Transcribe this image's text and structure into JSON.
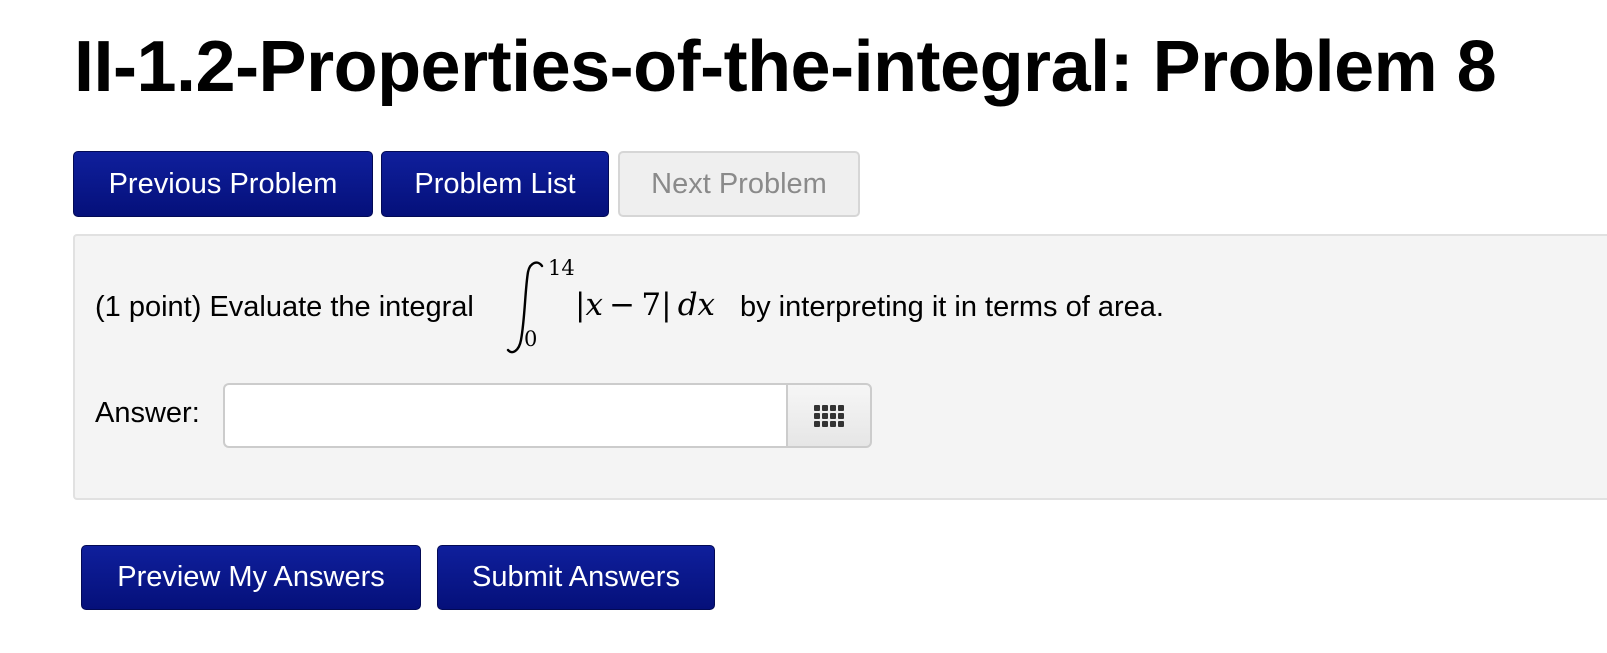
{
  "page": {
    "title": "II-1.2-Properties-of-the-integral: Problem 8"
  },
  "nav": {
    "previous_label": "Previous Problem",
    "list_label": "Problem List",
    "next_label": "Next Problem",
    "next_disabled": true
  },
  "problem": {
    "prefix_text": "(1 point) Evaluate the integral",
    "integral": {
      "lower_limit": "0",
      "upper_limit": "14",
      "integrand_var": "x",
      "integrand_op": "−",
      "integrand_const": "7",
      "differential": "dx"
    },
    "suffix_text": "by interpreting it in terms of area.",
    "answer_label": "Answer:",
    "answer_value": "",
    "answer_placeholder": "",
    "keypad_icon": "keypad-grid-icon"
  },
  "actions": {
    "preview_label": "Preview My Answers",
    "submit_label": "Submit Answers"
  },
  "colors": {
    "primary_button": "#0a1689",
    "disabled_button": "#efefef",
    "problem_box_bg": "#f4f4f4"
  }
}
